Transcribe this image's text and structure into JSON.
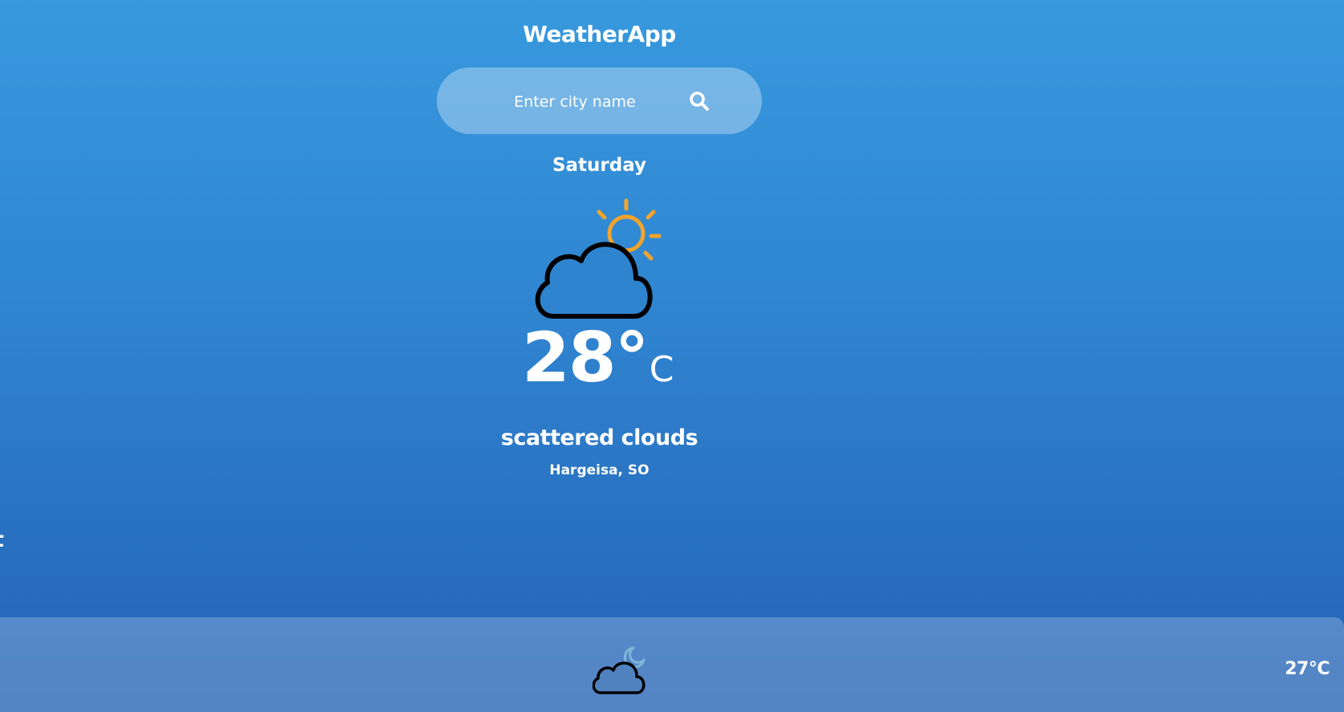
{
  "app": {
    "title": "WeatherApp"
  },
  "search": {
    "placeholder": "Enter city name",
    "value": "",
    "icon": "search-icon"
  },
  "current": {
    "day": "Saturday",
    "icon": "partly-cloudy-day-icon",
    "temperature": "28°",
    "unit": "C",
    "description": "scattered clouds",
    "location": "Hargeisa, SO"
  },
  "offscreen": {
    "partial_text": "t"
  },
  "forecast": {
    "items": [
      {
        "icon": "partly-cloudy-night-icon",
        "temperature": "27°C"
      }
    ]
  },
  "colors": {
    "background_top": "#3799de",
    "background_bottom": "#2461b4",
    "sun": "#f2a42b",
    "moon": "#7fb7d9",
    "cloud_outline": "#000000"
  }
}
